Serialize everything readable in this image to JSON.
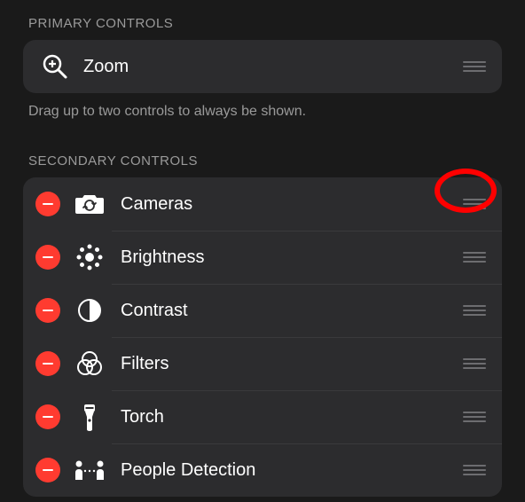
{
  "primarySection": {
    "header": "PRIMARY CONTROLS",
    "items": [
      {
        "label": "Zoom",
        "icon": "zoom-icon"
      }
    ],
    "hint": "Drag up to two controls to always be shown."
  },
  "secondarySection": {
    "header": "SECONDARY CONTROLS",
    "items": [
      {
        "label": "Cameras",
        "icon": "camera-switch-icon"
      },
      {
        "label": "Brightness",
        "icon": "brightness-icon"
      },
      {
        "label": "Contrast",
        "icon": "contrast-icon"
      },
      {
        "label": "Filters",
        "icon": "filters-icon"
      },
      {
        "label": "Torch",
        "icon": "torch-icon"
      },
      {
        "label": "People Detection",
        "icon": "people-detection-icon"
      }
    ]
  }
}
